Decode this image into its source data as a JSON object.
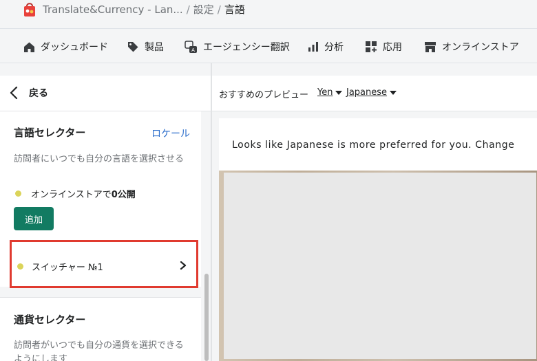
{
  "topbar": {
    "app_name": "Translate&Currency - Lan...",
    "crumb_sep": "/",
    "crumb_settings": "設定",
    "crumb_current": "言語"
  },
  "nav": {
    "dashboard": "ダッシュボード",
    "products": "製品",
    "agency": "エージェンシー翻訳",
    "analytics": "分析",
    "apps": "応用",
    "store": "オンラインストア"
  },
  "back": {
    "label": "戻る"
  },
  "preview_bar": {
    "label": "おすすめのプレビュー",
    "currency": "Yen",
    "language": "Japanese"
  },
  "language_selector": {
    "title": "言語セレクター",
    "link": "ロケール",
    "description": "訪問者にいつでも自分の言語を選択させる",
    "status_prefix": "オンラインストアで",
    "status_count": "0公開",
    "status_color": "#dbd45a",
    "add_button": "追加",
    "switcher_label": "スイッチャー №1"
  },
  "currency_selector": {
    "title": "通貨セレクター",
    "description": "訪問者がいつでも自分の通貨を選択できるようにします"
  },
  "preview": {
    "banner_text": "Looks like Japanese is more preferred for you. Change"
  },
  "colors": {
    "accent_link": "#2c6ecb",
    "primary_button": "#127b62",
    "highlight_border": "#e03a2f"
  }
}
